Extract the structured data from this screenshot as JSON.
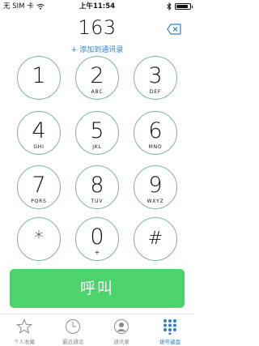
{
  "status_bar": {
    "carrier": "无 SIM 卡",
    "time": "上午11:54",
    "battery_level": 0.9
  },
  "dialer": {
    "number": "163",
    "add_contact": "+ 添加到通讯录"
  },
  "keys": [
    {
      "digit": "1",
      "letters": ""
    },
    {
      "digit": "2",
      "letters": "ABC"
    },
    {
      "digit": "3",
      "letters": "DEF"
    },
    {
      "digit": "4",
      "letters": "GHI"
    },
    {
      "digit": "5",
      "letters": "JKL"
    },
    {
      "digit": "6",
      "letters": "MNO"
    },
    {
      "digit": "7",
      "letters": "PQRS"
    },
    {
      "digit": "8",
      "letters": "TUV"
    },
    {
      "digit": "9",
      "letters": "WXYZ"
    },
    {
      "digit": "*",
      "letters": ""
    },
    {
      "digit": "0",
      "letters": "+"
    },
    {
      "digit": "#",
      "letters": ""
    }
  ],
  "call_button": {
    "label": "呼叫"
  },
  "tabs": [
    {
      "label": "个人收藏",
      "icon": "star-icon"
    },
    {
      "label": "最近通话",
      "icon": "clock-icon"
    },
    {
      "label": "通讯录",
      "icon": "contacts-icon"
    },
    {
      "label": "拨号键盘",
      "icon": "keypad-icon",
      "active": true
    }
  ],
  "colors": {
    "accent": "#2d7fd0",
    "call_green": "#4cd36b",
    "key_ring": "#7bb3a3"
  }
}
